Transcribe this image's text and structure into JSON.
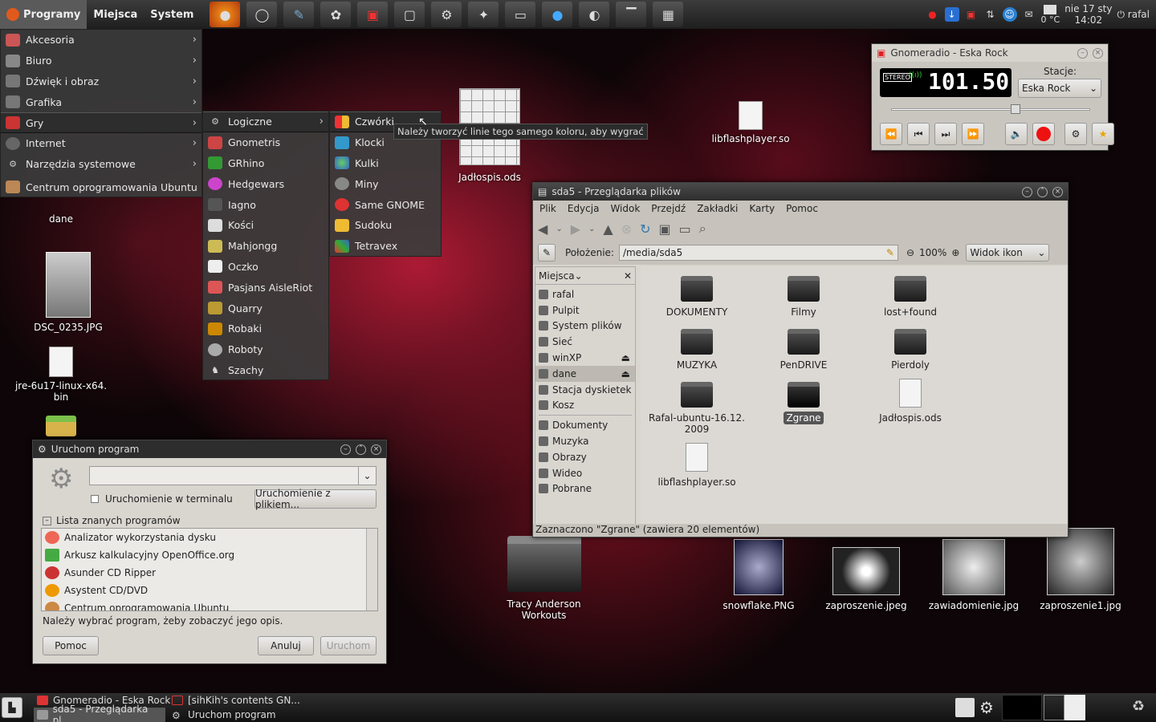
{
  "top_panel": {
    "menus": [
      "Programy",
      "Miejsca",
      "System"
    ],
    "launchers": [
      "firefox-icon",
      "browser-icon",
      "editor-icon",
      "gimp-icon",
      "radio-icon",
      "window-icon",
      "settings-icon",
      "pidgin-icon",
      "terminal-icon",
      "drop-icon",
      "screenshot-icon",
      "xkill-icon",
      "mixer-icon"
    ],
    "date": "nie 17 sty",
    "time": "14:02",
    "temp": "0 °C",
    "user": "rafal"
  },
  "app_menu": {
    "items": [
      {
        "label": "Akcesoria",
        "icon": "accessories-icon",
        "sub": true
      },
      {
        "label": "Biuro",
        "icon": "office-icon",
        "sub": true
      },
      {
        "label": "Dźwięk i obraz",
        "icon": "multimedia-icon",
        "sub": true
      },
      {
        "label": "Grafika",
        "icon": "graphics-icon",
        "sub": true
      },
      {
        "label": "Gry",
        "icon": "games-icon",
        "sub": true
      },
      {
        "label": "Internet",
        "icon": "internet-icon",
        "sub": true
      },
      {
        "label": "Narzędzia systemowe",
        "icon": "system-tools-icon",
        "sub": true
      },
      {
        "label": "Centrum oprogramowania Ubuntu",
        "icon": "software-center-icon",
        "sub": false
      }
    ]
  },
  "games_menu": {
    "items": [
      "Logiczne",
      "Gnometris",
      "GRhino",
      "Hedgewars",
      "Iagno",
      "Kości",
      "Mahjongg",
      "Oczko",
      "Pasjans AisleRiot",
      "Quarry",
      "Robaki",
      "Roboty",
      "Szachy"
    ]
  },
  "logic_menu": {
    "items": [
      "Czwórki",
      "Klocki",
      "Kulki",
      "Miny",
      "Same GNOME",
      "Sudoku",
      "Tetravex"
    ],
    "tooltip": "Należy tworzyć linie tego samego koloru, aby wygrać"
  },
  "desktop": {
    "icons": [
      "dane",
      "DSC_0235.JPG",
      "jre-6u17-linux-x64.\nbin",
      "Jadłospis.ods",
      "libflashplayer.so",
      "Tracy Anderson Workouts",
      "snowflake.PNG",
      "zaproszenie.jpeg",
      "zawiadomienie.jpg",
      "zaproszenie1.jpg"
    ]
  },
  "radio": {
    "title": "Gnomeradio - Eska Rock",
    "stereo": "STEREO",
    "frequency": "101.50",
    "stations_label": "Stacje:",
    "station": "Eska Rock",
    "volume": 0.62
  },
  "file_manager": {
    "title": "sda5 - Przeglądarka plików",
    "menu": [
      "Plik",
      "Edycja",
      "Widok",
      "Przejdź",
      "Zakładki",
      "Karty",
      "Pomoc"
    ],
    "location_label": "Położenie:",
    "location": "/media/sda5",
    "zoom": "100%",
    "view_mode": "Widok ikon",
    "sidebar_header": "Miejsca",
    "places": [
      "rafal",
      "Pulpit",
      "System plików",
      "Sieć",
      "winXP",
      "dane",
      "Stacja dyskietek",
      "Kosz"
    ],
    "bookmarks": [
      "Dokumenty",
      "Muzyka",
      "Obrazy",
      "Wideo",
      "Pobrane"
    ],
    "items": [
      {
        "name": "DOKUMENTY"
      },
      {
        "name": "Filmy"
      },
      {
        "name": "lost+found"
      },
      {
        "name": "MUZYKA"
      },
      {
        "name": "PenDRIVE"
      },
      {
        "name": "Pierdoly"
      },
      {
        "name": "Rafal-ubuntu-16.12.\n2009"
      },
      {
        "name": "Zgrane"
      },
      {
        "name": "Jadłospis.ods"
      },
      {
        "name": "libflashplayer.so"
      }
    ],
    "status": "Zaznaczono \"Zgrane\" (zawiera 20 elementów)"
  },
  "run_dialog": {
    "title": "Uruchom program",
    "command": "",
    "terminal_label": "Uruchomienie w terminalu",
    "file_button": "Uruchomienie z plikiem...",
    "list_header": "Lista znanych programów",
    "programs": [
      "Analizator wykorzystania dysku",
      "Arkusz kalkulacyjny OpenOffice.org",
      "Asunder CD Ripper",
      "Asystent CD/DVD",
      "Centrum oprogramowania Ubuntu"
    ],
    "hint": "Należy wybrać program, żeby zobaczyć jego opis.",
    "help": "Pomoc",
    "cancel": "Anuluj",
    "run": "Uruchom"
  },
  "taskbar": {
    "tasks": [
      "Gnomeradio - Eska Rock",
      "[sihKih's contents GN...",
      "sda5 - Przeglądarka pl...",
      "Uruchom program"
    ]
  }
}
